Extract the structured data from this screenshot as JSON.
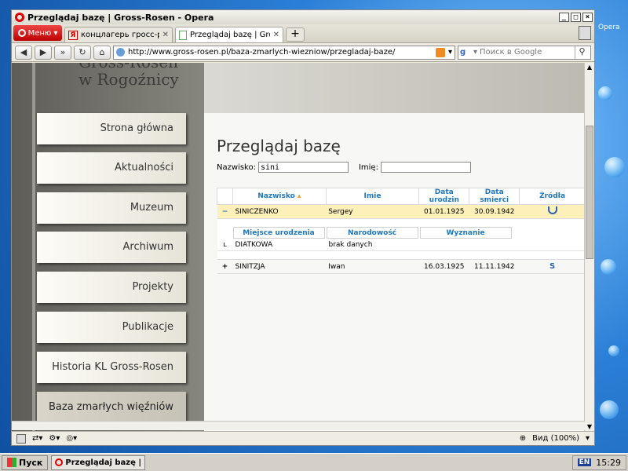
{
  "window": {
    "title": "Przeglądaj bazę | Gross-Rosen - Opera"
  },
  "desktop": {
    "partial_label": "Opera"
  },
  "browser": {
    "menu_label": "Меню",
    "tabs": [
      {
        "label": "концлагерь гросс-розе...",
        "icon": "yandex-icon",
        "active": false
      },
      {
        "label": "Przeglądaj bazę | Gross-...",
        "icon": "page-icon",
        "active": true
      }
    ],
    "url": "http://www.gross-rosen.pl/baza-zmarlych-wiezniow/przegladaj-baze/",
    "search_placeholder": "Поиск в Google",
    "zoom_label": "Вид (100%)"
  },
  "site": {
    "logo_line1": "Gross-Rosen",
    "logo_line2": "w Rogoźnicy",
    "nav": [
      {
        "label": "Strona główna",
        "active": false
      },
      {
        "label": "Aktualności",
        "active": false
      },
      {
        "label": "Muzeum",
        "active": false
      },
      {
        "label": "Archiwum",
        "active": false
      },
      {
        "label": "Projekty",
        "active": false
      },
      {
        "label": "Publikacje",
        "active": false
      },
      {
        "label": "Historia KL Gross-Rosen",
        "active": false
      },
      {
        "label": "Baza zmarłych więźniów",
        "active": true
      }
    ]
  },
  "content": {
    "heading": "Przeglądaj bazę",
    "surname_label": "Nazwisko:",
    "surname_value": "sini",
    "firstname_label": "Imię:",
    "firstname_value": "",
    "columns": [
      "Nazwisko",
      "Imie",
      "Data urodzin",
      "Data smierci",
      "Źródła"
    ],
    "rows": [
      {
        "toggle": "−",
        "surname": "SINICZENKO",
        "firstname": "Sergey",
        "born": "01.01.1925",
        "died": "30.09.1942",
        "source_icon": "source-u-icon"
      },
      {
        "toggle": "+",
        "surname": "SINITZJA",
        "firstname": "Iwan",
        "born": "16.03.1925",
        "died": "11.11.1942",
        "source_icon": "source-s-icon"
      }
    ],
    "detail": {
      "columns": [
        "Miejsce urodzenia",
        "Narodowość",
        "Wyznanie"
      ],
      "marker": "ʟ",
      "values": [
        "DIATKOWA",
        "brak danych",
        ""
      ]
    }
  },
  "taskbar": {
    "start_label": "Пуск",
    "task_label": "Przeglądaj bazę | Gro...",
    "lang": "EN",
    "clock": "15:29"
  }
}
